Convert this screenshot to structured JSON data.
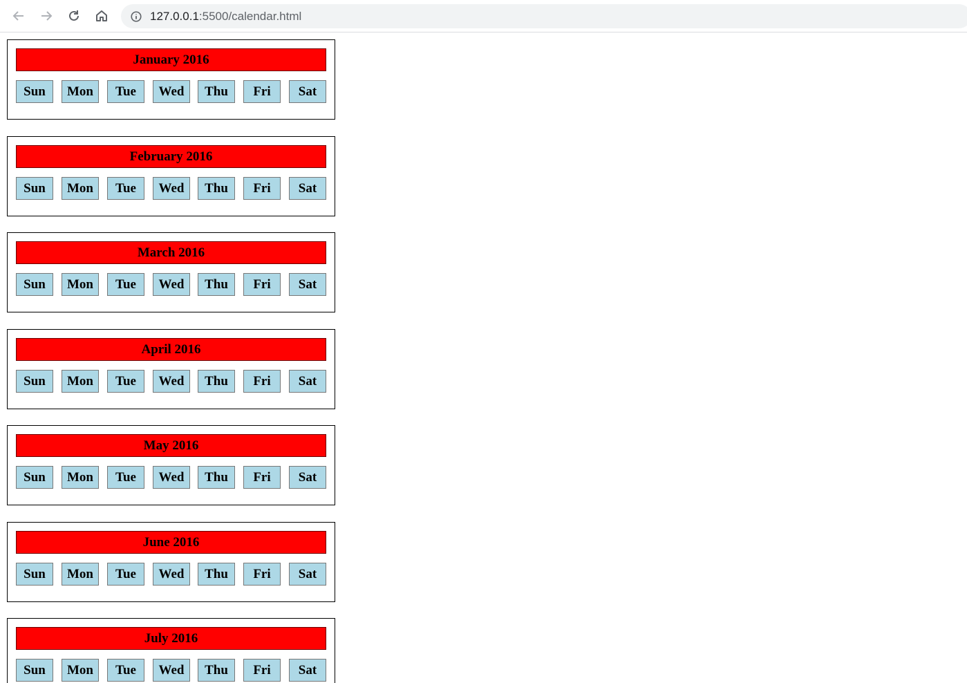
{
  "browser": {
    "url_host": "127.0.0.1",
    "url_path": ":5500/calendar.html"
  },
  "weekdays": [
    "Sun",
    "Mon",
    "Tue",
    "Wed",
    "Thu",
    "Fri",
    "Sat"
  ],
  "months": [
    {
      "title": "January 2016"
    },
    {
      "title": "February 2016"
    },
    {
      "title": "March 2016"
    },
    {
      "title": "April 2016"
    },
    {
      "title": "May 2016"
    },
    {
      "title": "June 2016"
    },
    {
      "title": "July 2016"
    }
  ],
  "colors": {
    "month_header_bg": "#ff0000",
    "day_cell_bg": "#add8e6"
  }
}
